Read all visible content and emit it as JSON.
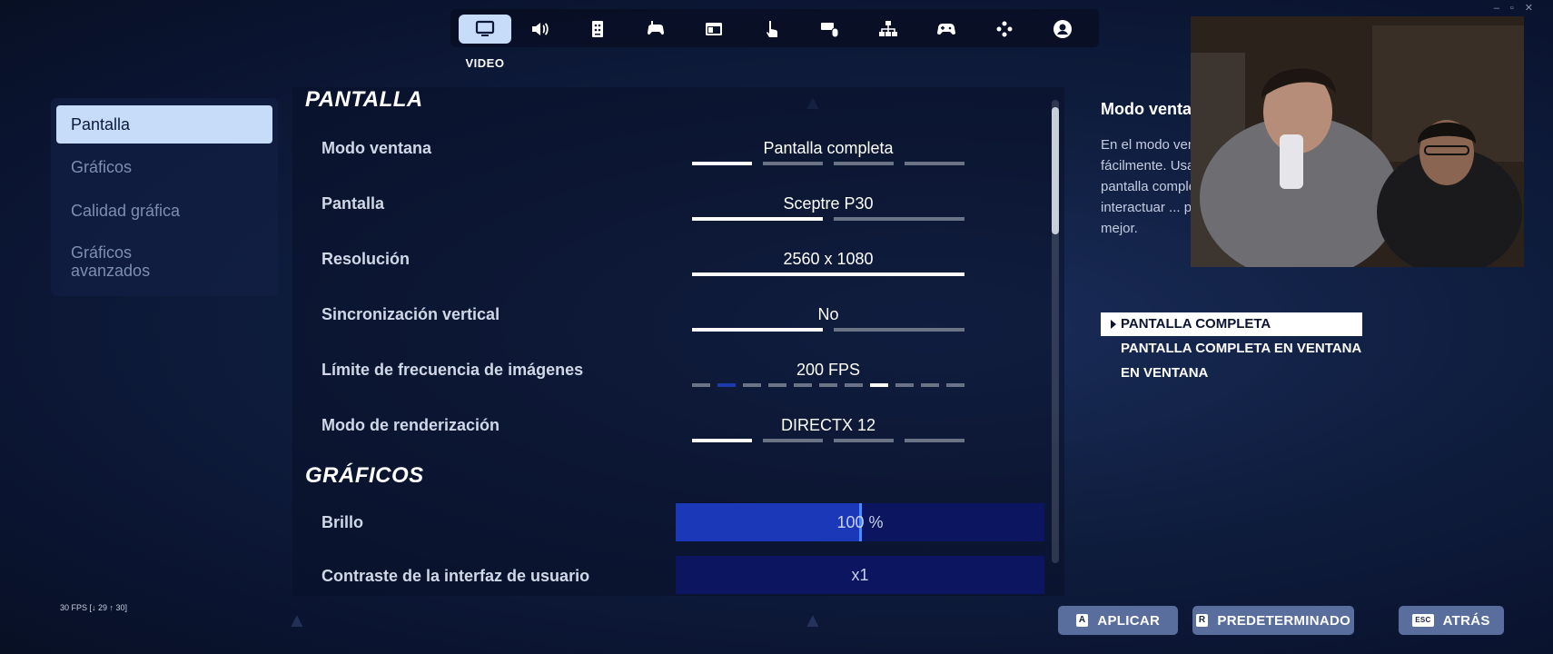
{
  "tabs": [
    {
      "icon": "monitor-icon",
      "active": true
    },
    {
      "icon": "speaker-icon",
      "active": false
    },
    {
      "icon": "accessibility-icon",
      "active": false
    },
    {
      "icon": "controller-touch-icon",
      "active": false
    },
    {
      "icon": "window-icon",
      "active": false
    },
    {
      "icon": "touch-hand-icon",
      "active": false
    },
    {
      "icon": "keyboard-mouse-icon",
      "active": false
    },
    {
      "icon": "network-icon",
      "active": false
    },
    {
      "icon": "gamepad-icon",
      "active": false
    },
    {
      "icon": "dpad-icon",
      "active": false
    },
    {
      "icon": "account-icon",
      "active": false
    }
  ],
  "active_tab_label": "VIDEO",
  "leftnav": {
    "items": [
      {
        "label": "Pantalla",
        "active": true
      },
      {
        "label": "Gráficos",
        "active": false
      },
      {
        "label": "Calidad gráfica",
        "active": false
      },
      {
        "label": "Gráficos avanzados",
        "active": false
      }
    ]
  },
  "sections": {
    "pantalla_title": "PANTALLA",
    "graficos_title": "GRÁFICOS"
  },
  "rows": [
    {
      "label": "Modo ventana",
      "value": "Pantalla completa",
      "segments": 4,
      "selected": 0
    },
    {
      "label": "Pantalla",
      "value": "Sceptre P30",
      "segments": 2,
      "selected": 0
    },
    {
      "label": "Resolución",
      "value": "2560 x 1080",
      "segments": 1,
      "selected": 0
    },
    {
      "label": "Sincronización vertical",
      "value": "No",
      "segments": 2,
      "selected": 0
    },
    {
      "label": "Límite de frecuencia de imágenes",
      "value": "200 FPS",
      "segments": 11,
      "selected": 7,
      "highlight": 1
    },
    {
      "label": "Modo de renderización",
      "value": "DIRECTX 12",
      "segments": 4,
      "selected": 0
    }
  ],
  "sliders": [
    {
      "label": "Brillo",
      "value_text": "100 %",
      "fraction": 0.5
    },
    {
      "label": "Contraste de la interfaz de usuario",
      "value_text": "x1",
      "fraction": 0.0
    }
  ],
  "description": {
    "title": "Modo ventana",
    "text": "En el modo ventana puedes usar varias ventanas más fácilmente. Usa pantalla completa en ventana para ... pantalla completa en ... aplicación a ... puedes interactuar ... pero el juego podría funcionar un poco mejor.",
    "options": [
      {
        "label": "PANTALLA COMPLETA",
        "selected": true
      },
      {
        "label": "PANTALLA COMPLETA EN VENTANA",
        "selected": false
      },
      {
        "label": "EN VENTANA",
        "selected": false
      }
    ]
  },
  "buttons": [
    {
      "key": "A",
      "label": "APLICAR"
    },
    {
      "key": "R",
      "label": "PREDETERMINADO"
    },
    {
      "key": "ESC",
      "label": "ATRÁS"
    }
  ],
  "fps_counter": "30 FPS [↓ 29 ↑ 30]",
  "colors": {
    "accent_light": "#c7dcf8",
    "slider_fill": "#1a38b8",
    "slider_bg": "#0c1660",
    "button_bg": "#5a6e9e"
  }
}
